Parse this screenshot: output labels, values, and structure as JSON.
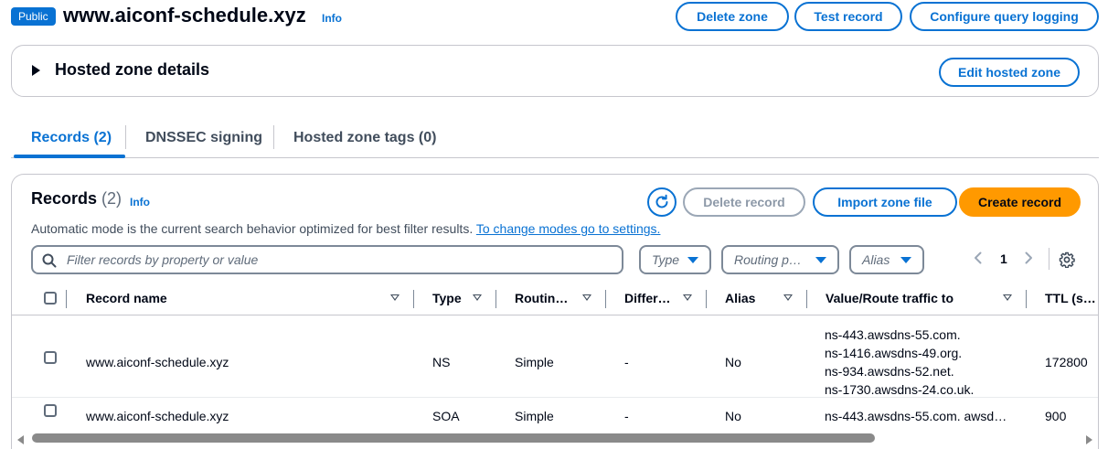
{
  "header": {
    "badge": "Public",
    "title": "www.aiconf-schedule.xyz",
    "info": "Info",
    "buttons": {
      "delete_zone": "Delete zone",
      "test_record": "Test record",
      "configure_logging": "Configure query logging"
    }
  },
  "details": {
    "title": "Hosted zone details",
    "edit_button": "Edit hosted zone"
  },
  "tabs": [
    {
      "label": "Records (2)",
      "active": true
    },
    {
      "label": "DNSSEC signing",
      "active": false
    },
    {
      "label": "Hosted zone tags (0)",
      "active": false
    }
  ],
  "records": {
    "title": "Records",
    "count": "(2)",
    "info": "Info",
    "buttons": {
      "delete_record": "Delete record",
      "import_zone_file": "Import zone file",
      "create_record": "Create record"
    },
    "description": "Automatic mode is the current search behavior optimized for best filter results.",
    "description_link": "To change modes go to settings.",
    "search_placeholder": "Filter records by property or value",
    "filters": {
      "type": "Type",
      "routing": "Routing p…",
      "alias": "Alias"
    },
    "page": "1",
    "columns": {
      "record_name": "Record name",
      "type": "Type",
      "routing": "Routin…",
      "differ": "Differ…",
      "alias": "Alias",
      "value": "Value/Route traffic to",
      "ttl": "TTL (s…"
    },
    "rows": [
      {
        "name": "www.aiconf-schedule.xyz",
        "type": "NS",
        "routing": "Simple",
        "differ": "-",
        "alias": "No",
        "values": [
          "ns-443.awsdns-55.com.",
          "ns-1416.awsdns-49.org.",
          "ns-934.awsdns-52.net.",
          "ns-1730.awsdns-24.co.uk."
        ],
        "ttl": "172800"
      },
      {
        "name": "www.aiconf-schedule.xyz",
        "type": "SOA",
        "routing": "Simple",
        "differ": "-",
        "alias": "No",
        "values": [
          "ns-443.awsdns-55.com. awsd…"
        ],
        "ttl": "900"
      }
    ]
  },
  "colors": {
    "accent": "#0972d3",
    "primary_button": "#ff9900",
    "border": "#c6c6cd"
  },
  "icons": [
    "refresh-icon",
    "search-icon",
    "chevron-left-icon",
    "chevron-right-icon",
    "settings-gear-icon",
    "caret-down-icon",
    "sort-icon"
  ]
}
